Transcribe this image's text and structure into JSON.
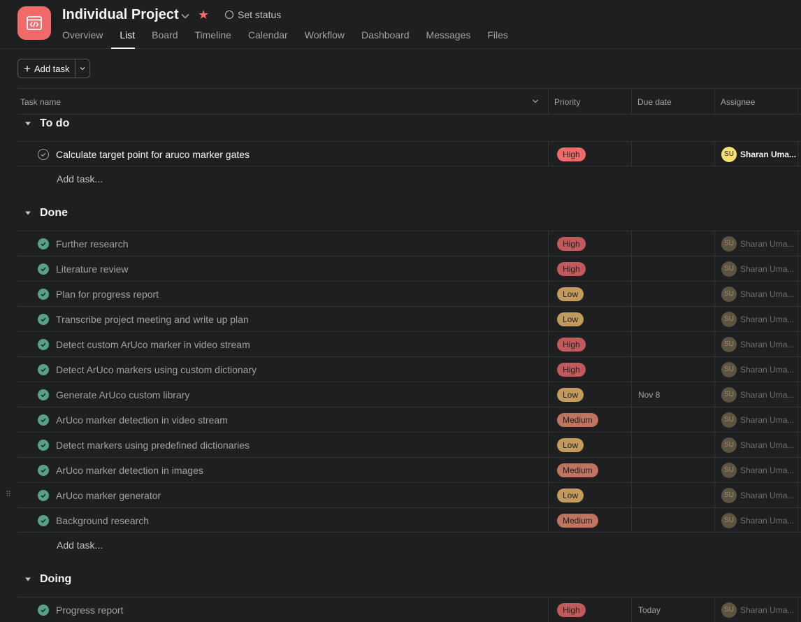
{
  "project": {
    "title": "Individual Project",
    "set_status": "Set status",
    "tabs": [
      "Overview",
      "List",
      "Board",
      "Timeline",
      "Calendar",
      "Workflow",
      "Dashboard",
      "Messages",
      "Files"
    ]
  },
  "toolbar": {
    "add_task": "Add task"
  },
  "columns": {
    "task": "Task name",
    "priority": "Priority",
    "due": "Due date",
    "assignee": "Assignee"
  },
  "sections": {
    "todo": {
      "label": "To do",
      "add_task": "Add task...",
      "tasks": [
        {
          "name": "Calculate target point for aruco marker gates",
          "priority": "High",
          "due": "",
          "assignee": "Sharan Uma...",
          "initials": "SU"
        }
      ]
    },
    "done": {
      "label": "Done",
      "add_task": "Add task...",
      "tasks": [
        {
          "name": "Further research",
          "priority": "High",
          "due": "",
          "assignee": "Sharan Uma...",
          "initials": "SU"
        },
        {
          "name": "Literature review",
          "priority": "High",
          "due": "",
          "assignee": "Sharan Uma...",
          "initials": "SU"
        },
        {
          "name": "Plan for progress report",
          "priority": "Low",
          "due": "",
          "assignee": "Sharan Uma...",
          "initials": "SU"
        },
        {
          "name": "Transcribe project meeting and write up plan",
          "priority": "Low",
          "due": "",
          "assignee": "Sharan Uma...",
          "initials": "SU"
        },
        {
          "name": "Detect custom ArUco marker in video stream",
          "priority": "High",
          "due": "",
          "assignee": "Sharan Uma...",
          "initials": "SU"
        },
        {
          "name": "Detect ArUco markers using custom dictionary",
          "priority": "High",
          "due": "",
          "assignee": "Sharan Uma...",
          "initials": "SU"
        },
        {
          "name": "Generate ArUco custom library",
          "priority": "Low",
          "due": "Nov 8",
          "assignee": "Sharan Uma...",
          "initials": "SU"
        },
        {
          "name": "ArUco marker detection in video stream",
          "priority": "Medium",
          "due": "",
          "assignee": "Sharan Uma...",
          "initials": "SU"
        },
        {
          "name": "Detect markers using predefined dictionaries",
          "priority": "Low",
          "due": "",
          "assignee": "Sharan Uma...",
          "initials": "SU"
        },
        {
          "name": "ArUco marker detection in images",
          "priority": "Medium",
          "due": "",
          "assignee": "Sharan Uma...",
          "initials": "SU"
        },
        {
          "name": "ArUco marker generator",
          "priority": "Low",
          "due": "",
          "assignee": "Sharan Uma...",
          "initials": "SU"
        },
        {
          "name": "Background research",
          "priority": "Medium",
          "due": "",
          "assignee": "Sharan Uma...",
          "initials": "SU"
        }
      ]
    },
    "doing": {
      "label": "Doing",
      "tasks": [
        {
          "name": "Progress report",
          "priority": "High",
          "due": "Today",
          "assignee": "Sharan Uma...",
          "initials": "SU"
        }
      ]
    }
  },
  "colors": {
    "high": "#f06a6a",
    "low": "#f1bd6c",
    "medium": "#ec8d71",
    "done_check": "#58a182",
    "background": "#1e1f21"
  }
}
